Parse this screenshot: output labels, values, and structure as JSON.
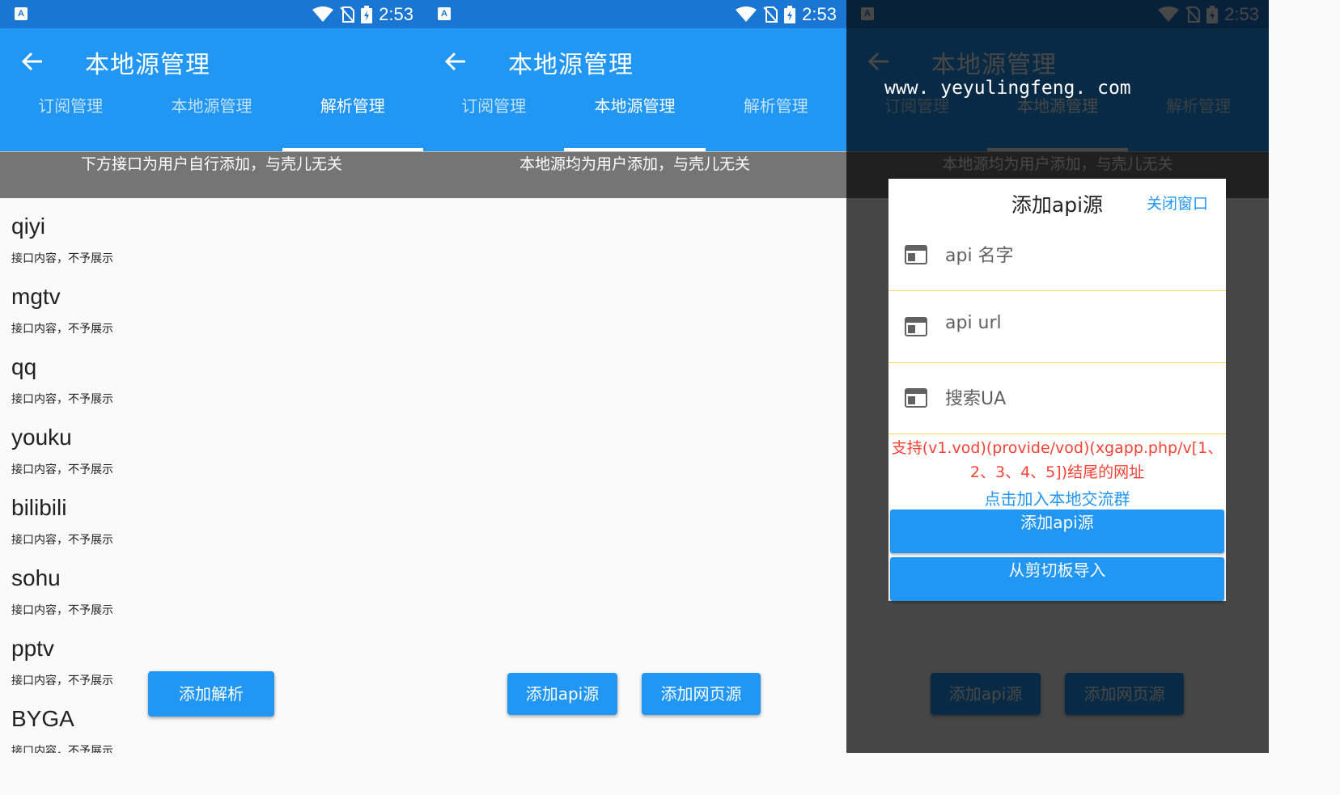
{
  "status": {
    "time": "2:53",
    "app_badge": "A"
  },
  "appbar": {
    "title": "本地源管理"
  },
  "tabs": [
    "订阅管理",
    "本地源管理",
    "解析管理"
  ],
  "panel1": {
    "notice": "下方接口为用户自行添加，与壳儿无关",
    "items": [
      {
        "name": "qiyi",
        "desc": "接口内容，不予展示"
      },
      {
        "name": "mgtv",
        "desc": "接口内容，不予展示"
      },
      {
        "name": "qq",
        "desc": "接口内容，不予展示"
      },
      {
        "name": "youku",
        "desc": "接口内容，不予展示"
      },
      {
        "name": "bilibili",
        "desc": "接口内容，不予展示"
      },
      {
        "name": "sohu",
        "desc": "接口内容，不予展示"
      },
      {
        "name": "pptv",
        "desc": "接口内容，不予展示"
      },
      {
        "name": "BYGA",
        "desc": "接口内容，不予展示"
      }
    ],
    "add_parse_label": "添加解析"
  },
  "panel2": {
    "notice": "本地源均为用户添加，与壳儿无关",
    "add_api_label": "添加api源",
    "add_web_label": "添加网页源"
  },
  "panel3": {
    "watermark": "www. yeyulingfeng. com",
    "dialog": {
      "title": "添加api源",
      "close_label": "关闭窗口",
      "fields": [
        "api 名字",
        "api url",
        "搜索UA"
      ],
      "hint_line1": "支持(v1.vod)(provide/vod)(xgapp.php/v[1、",
      "hint_line2": "2、3、4、5])结尾的网址",
      "link": "点击加入本地交流群",
      "add_button": "添加api源",
      "clipboard_button": "从剪切板导入"
    }
  },
  "colors": {
    "primary": "#2196f3",
    "status_bar": "#1976d2",
    "notice_bg": "#757575",
    "hint": "#f44336",
    "divider": "#ffd54f"
  }
}
